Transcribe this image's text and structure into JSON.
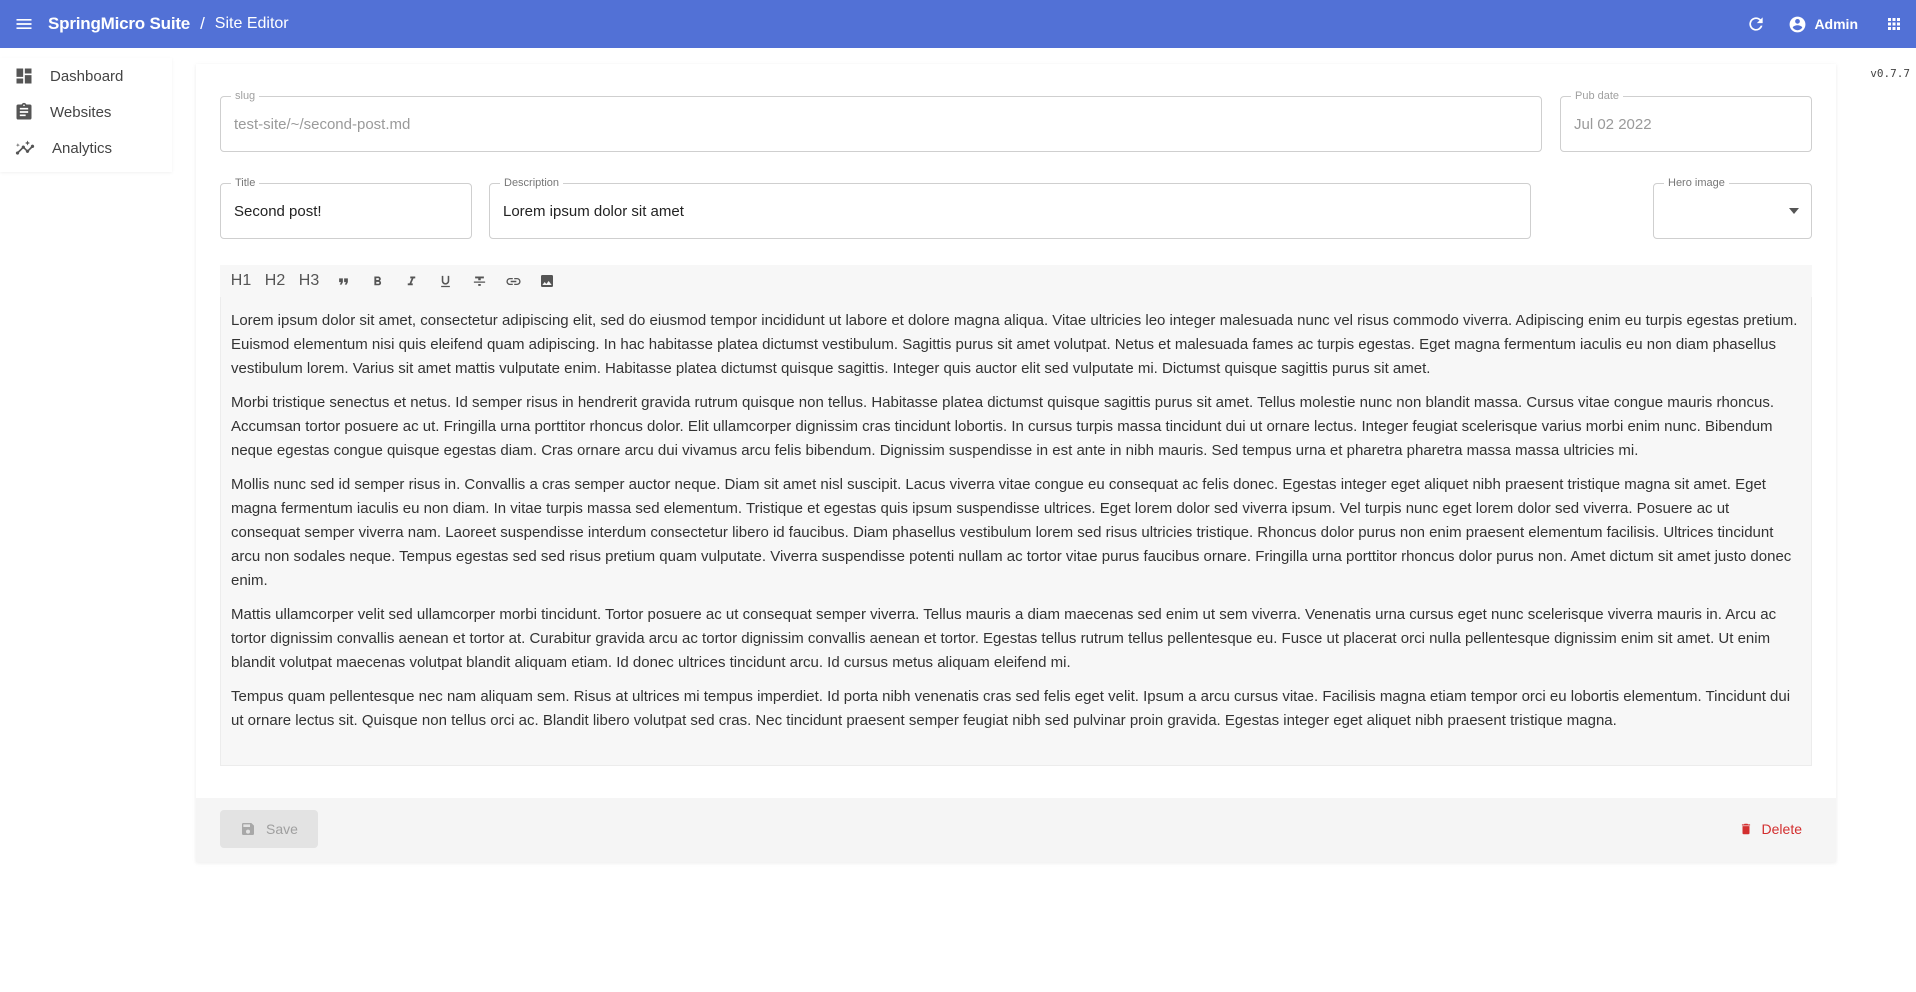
{
  "header": {
    "brand": "SpringMicro Suite",
    "separator": "/",
    "section": "Site Editor",
    "user": "Admin",
    "icons": [
      "menu-icon",
      "refresh-icon",
      "account-circle-icon",
      "apps-grid-icon"
    ],
    "color": "#5271d6"
  },
  "sidebar": {
    "items": [
      {
        "label": "Dashboard",
        "icon": "dashboard-icon"
      },
      {
        "label": "Websites",
        "icon": "clipboard-icon"
      },
      {
        "label": "Analytics",
        "icon": "analytics-icon"
      }
    ]
  },
  "version": "v0.7.7",
  "form": {
    "slug": {
      "label": "slug",
      "value": "test-site/~/second-post.md"
    },
    "pub_date": {
      "label": "Pub date",
      "value": "Jul 02 2022"
    },
    "title": {
      "label": "Title",
      "value": "Second post!"
    },
    "description": {
      "label": "Description",
      "value": "Lorem ipsum dolor sit amet"
    },
    "hero_image": {
      "label": "Hero image",
      "value": ""
    }
  },
  "toolbar": {
    "h1": "H1",
    "h2": "H2",
    "h3": "H3",
    "icons": [
      "quote-icon",
      "bold-icon",
      "italic-icon",
      "underline-icon",
      "strikethrough-icon",
      "link-icon",
      "image-icon"
    ]
  },
  "editor": {
    "paragraphs": [
      "Lorem ipsum dolor sit amet, consectetur adipiscing elit, sed do eiusmod tempor incididunt ut labore et dolore magna aliqua. Vitae ultricies leo integer malesuada nunc vel risus commodo viverra. Adipiscing enim eu turpis egestas pretium. Euismod elementum nisi quis eleifend quam adipiscing. In hac habitasse platea dictumst vestibulum. Sagittis purus sit amet volutpat. Netus et malesuada fames ac turpis egestas. Eget magna fermentum iaculis eu non diam phasellus vestibulum lorem. Varius sit amet mattis vulputate enim. Habitasse platea dictumst quisque sagittis. Integer quis auctor elit sed vulputate mi. Dictumst quisque sagittis purus sit amet.",
      "Morbi tristique senectus et netus. Id semper risus in hendrerit gravida rutrum quisque non tellus. Habitasse platea dictumst quisque sagittis purus sit amet. Tellus molestie nunc non blandit massa. Cursus vitae congue mauris rhoncus. Accumsan tortor posuere ac ut. Fringilla urna porttitor rhoncus dolor. Elit ullamcorper dignissim cras tincidunt lobortis. In cursus turpis massa tincidunt dui ut ornare lectus. Integer feugiat scelerisque varius morbi enim nunc. Bibendum neque egestas congue quisque egestas diam. Cras ornare arcu dui vivamus arcu felis bibendum. Dignissim suspendisse in est ante in nibh mauris. Sed tempus urna et pharetra pharetra massa massa ultricies mi.",
      "Mollis nunc sed id semper risus in. Convallis a cras semper auctor neque. Diam sit amet nisl suscipit. Lacus viverra vitae congue eu consequat ac felis donec. Egestas integer eget aliquet nibh praesent tristique magna sit amet. Eget magna fermentum iaculis eu non diam. In vitae turpis massa sed elementum. Tristique et egestas quis ipsum suspendisse ultrices. Eget lorem dolor sed viverra ipsum. Vel turpis nunc eget lorem dolor sed viverra. Posuere ac ut consequat semper viverra nam. Laoreet suspendisse interdum consectetur libero id faucibus. Diam phasellus vestibulum lorem sed risus ultricies tristique. Rhoncus dolor purus non enim praesent elementum facilisis. Ultrices tincidunt arcu non sodales neque. Tempus egestas sed sed risus pretium quam vulputate. Viverra suspendisse potenti nullam ac tortor vitae purus faucibus ornare. Fringilla urna porttitor rhoncus dolor purus non. Amet dictum sit amet justo donec enim.",
      "Mattis ullamcorper velit sed ullamcorper morbi tincidunt. Tortor posuere ac ut consequat semper viverra. Tellus mauris a diam maecenas sed enim ut sem viverra. Venenatis urna cursus eget nunc scelerisque viverra mauris in. Arcu ac tortor dignissim convallis aenean et tortor at. Curabitur gravida arcu ac tortor dignissim convallis aenean et tortor. Egestas tellus rutrum tellus pellentesque eu. Fusce ut placerat orci nulla pellentesque dignissim enim sit amet. Ut enim blandit volutpat maecenas volutpat blandit aliquam etiam. Id donec ultrices tincidunt arcu. Id cursus metus aliquam eleifend mi.",
      "Tempus quam pellentesque nec nam aliquam sem. Risus at ultrices mi tempus imperdiet. Id porta nibh venenatis cras sed felis eget velit. Ipsum a arcu cursus vitae. Facilisis magna etiam tempor orci eu lobortis elementum. Tincidunt dui ut ornare lectus sit. Quisque non tellus orci ac. Blandit libero volutpat sed cras. Nec tincidunt praesent semper feugiat nibh sed pulvinar proin gravida. Egestas integer eget aliquet nibh praesent tristique magna."
    ]
  },
  "footer": {
    "save_label": "Save",
    "save_icon": "save-icon",
    "delete_label": "Delete",
    "delete_icon": "trash-icon",
    "delete_color": "#d32f2f"
  }
}
